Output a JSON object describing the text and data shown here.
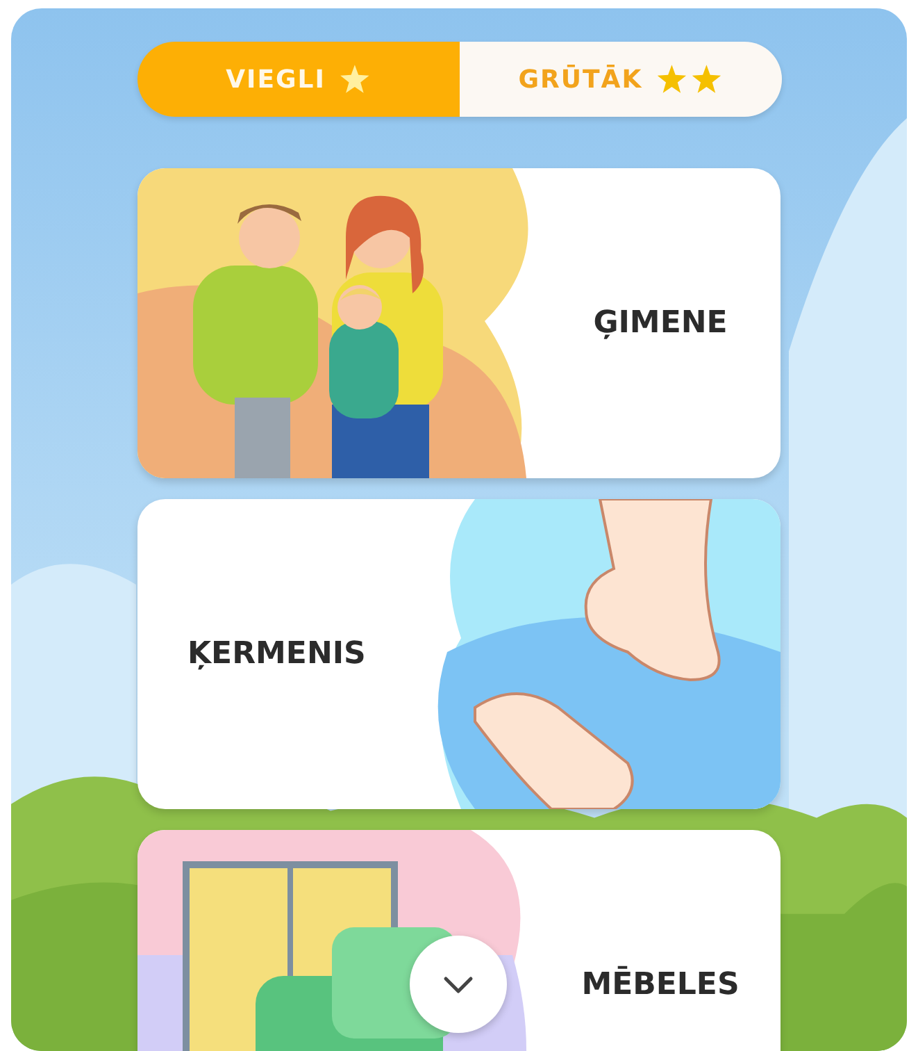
{
  "difficulty_tabs": [
    {
      "label": "VIEGLI",
      "kind": "easy",
      "selected": true
    },
    {
      "label": "GRŪTĀK",
      "kind": "hard",
      "selected": false
    }
  ],
  "topics": [
    {
      "title": "ĢIMENE",
      "kind": "family"
    },
    {
      "title": "ĶERMENIS",
      "kind": "body"
    },
    {
      "title": "MĒBELES",
      "kind": "furniture"
    }
  ]
}
